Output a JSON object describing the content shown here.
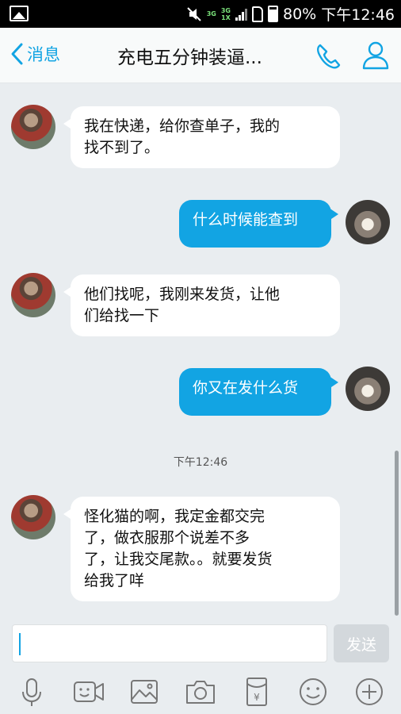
{
  "status_bar": {
    "network_1": "3G",
    "network_2": "3G\n1X",
    "battery": "80%",
    "time": "下午12:46"
  },
  "header": {
    "back_label": "消息",
    "title": "充电五分钟装逼..."
  },
  "messages": [
    {
      "side": "left",
      "lines": [
        "我在快递，给你查单子，我的",
        "找不到了。"
      ]
    },
    {
      "side": "right",
      "lines": [
        "什么时候能查到"
      ]
    },
    {
      "side": "left",
      "lines": [
        "他们找呢，我刚来发货，让他",
        "们给找一下"
      ]
    },
    {
      "side": "right",
      "lines": [
        "你又在发什么货"
      ]
    },
    {
      "side": "left",
      "lines": [
        "怪化猫的啊，我定金都交完",
        "了，做衣服那个说差不多",
        "了，让我交尾款。。就要发货",
        "给我了咩"
      ]
    }
  ],
  "timestamp": "下午12:46",
  "input": {
    "send_label": "发送"
  },
  "toolbar_icons": [
    "microphone-icon",
    "video-icon",
    "image-icon",
    "camera-icon",
    "red-packet-icon",
    "emoji-icon",
    "plus-icon"
  ],
  "colors": {
    "accent": "#12a4e3",
    "background": "#e9edf0"
  }
}
